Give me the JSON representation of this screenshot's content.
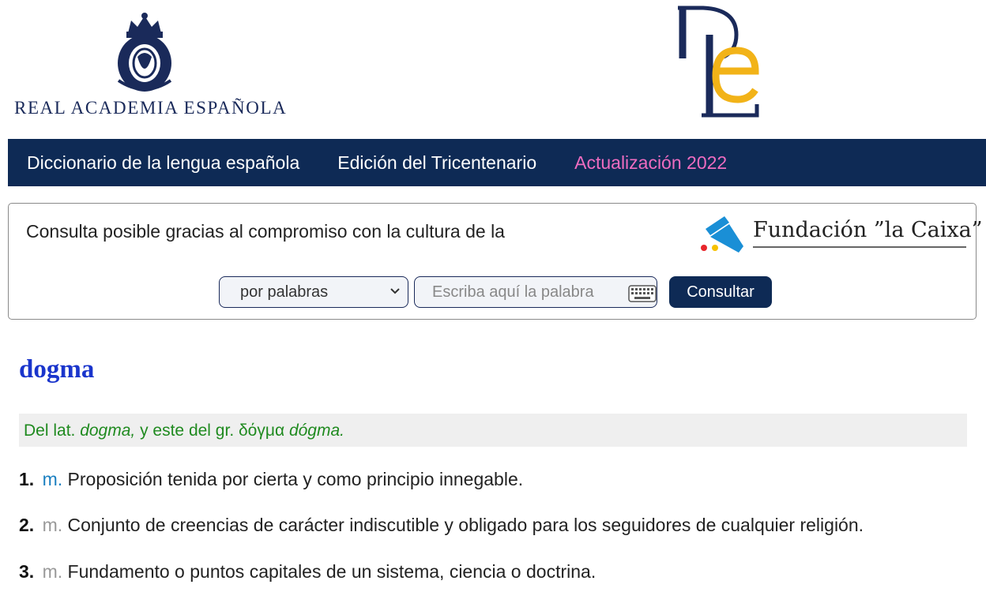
{
  "header": {
    "rae_logo_text": "REAL ACADEMIA ESPAÑOLA",
    "colors": {
      "navy": "#1a2a5a",
      "gold": "#f2b318"
    }
  },
  "nav": {
    "items": [
      {
        "label": "Diccionario de la lengua española"
      },
      {
        "label": "Edición del Tricentenario"
      },
      {
        "label": "Actualización 2022"
      }
    ],
    "colors": {
      "background": "#0e2a55",
      "highlight": "#ee6cc0"
    }
  },
  "search": {
    "sponsor_text": "Consulta posible gracias al compromiso con la cultura de la",
    "sponsor_logo_text": "Fundación ”la Caixa”",
    "mode_selected": "por palabras",
    "input_placeholder": "Escriba aquí la palabra",
    "button_label": "Consultar",
    "keyboard_icon": "keyboard-icon"
  },
  "entry": {
    "headword": "dogma",
    "etymology": {
      "p1": "Del lat. ",
      "latin": "dogma,",
      "p2": " y este del gr. δόγμα ",
      "greek": "dógma."
    },
    "senses": [
      {
        "number": "1.",
        "abbr": "m.",
        "definition": "Proposición tenida por cierta y como principio innegable."
      },
      {
        "number": "2.",
        "abbr": "m.",
        "definition": "Conjunto de creencias de carácter indiscutible y obligado para los seguidores de cualquier religión."
      },
      {
        "number": "3.",
        "abbr": "m.",
        "definition": "Fundamento o puntos capitales de un sistema, ciencia o doctrina."
      }
    ],
    "colors": {
      "headword": "#1a35cc",
      "etymology": "#1f8a1f",
      "abbr_first": "#1a7fc0",
      "abbr_rest": "#999999"
    }
  }
}
